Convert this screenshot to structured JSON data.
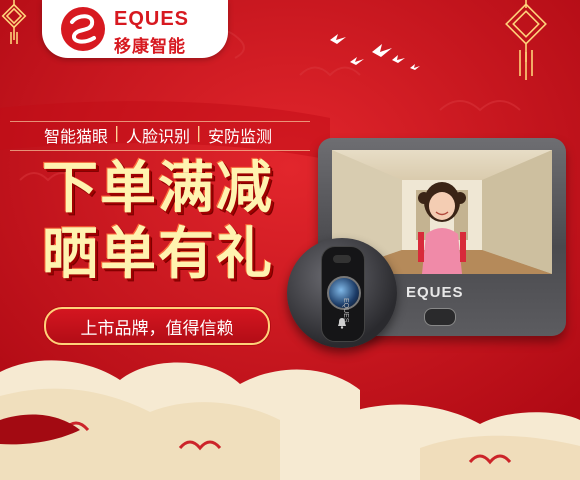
{
  "brand": {
    "name_en": "EQUES",
    "name_cn": "移康智能"
  },
  "tagline": {
    "items": [
      "智能猫眼",
      "人脸识别",
      "安防监测"
    ],
    "separator": "|"
  },
  "headline": {
    "line1": "下单满减",
    "line2": "晒单有礼"
  },
  "pill": {
    "label": "上市品牌，值得信赖"
  },
  "product": {
    "monitor_brand": "EQUES",
    "peephole_brand": "EQUES"
  },
  "colors": {
    "background_red": "#c8101a",
    "gold": "#ffd23a",
    "cream": "#f6ead2",
    "logo_red": "#d71920"
  },
  "icons": [
    "chinese-knot-icon",
    "dove-icon",
    "cloud-icon",
    "doorbell-icon"
  ]
}
